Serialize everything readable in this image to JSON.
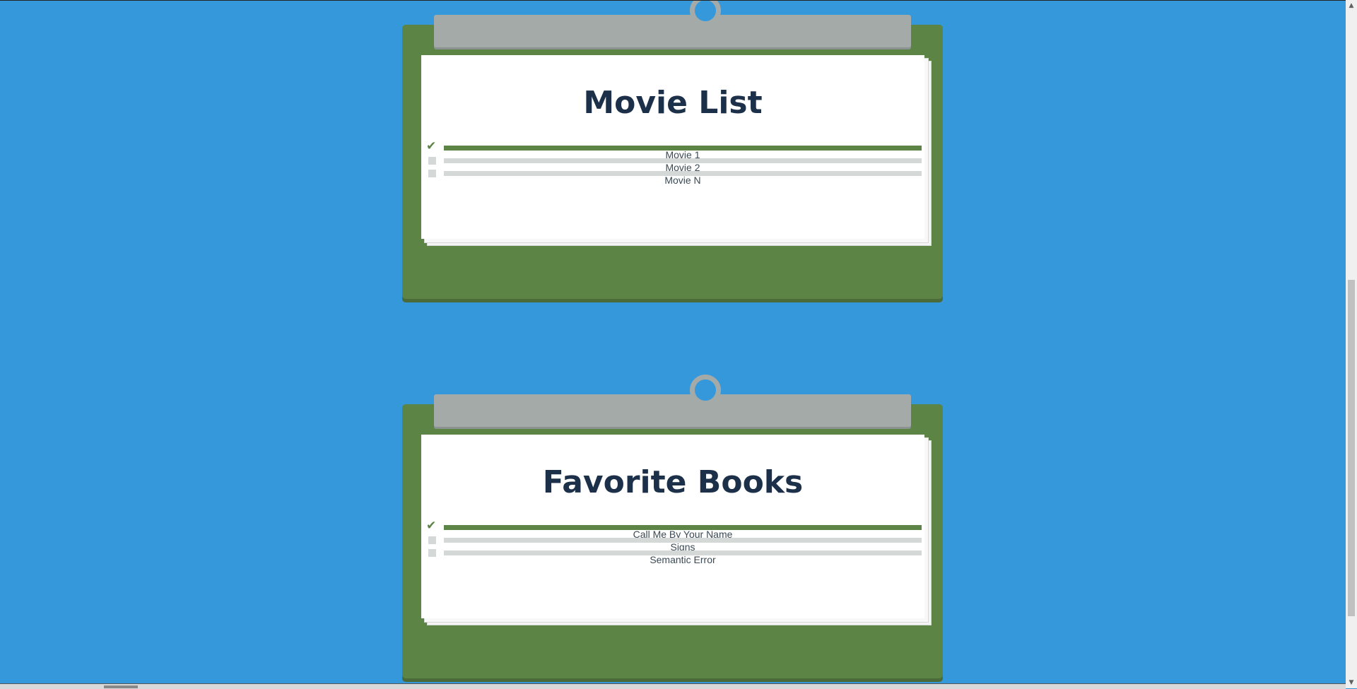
{
  "colors": {
    "background": "#3598db",
    "board": "#5b8445",
    "clip": "#a4aaa8",
    "title": "#1c3049",
    "bar_done": "#5b8445",
    "bar_pending": "#d4d9d7"
  },
  "lists": [
    {
      "title": "Movie List",
      "items": [
        {
          "label": "Movie 1",
          "done": true
        },
        {
          "label": "Movie 2",
          "done": false
        },
        {
          "label": "Movie N",
          "done": false
        }
      ]
    },
    {
      "title": "Favorite Books",
      "items": [
        {
          "label": "Call Me By Your Name",
          "done": true
        },
        {
          "label": "Signs",
          "done": false
        },
        {
          "label": "Semantic Error",
          "done": false
        }
      ]
    }
  ],
  "icons": {
    "check": "check-icon",
    "checkbox": "checkbox-icon"
  }
}
